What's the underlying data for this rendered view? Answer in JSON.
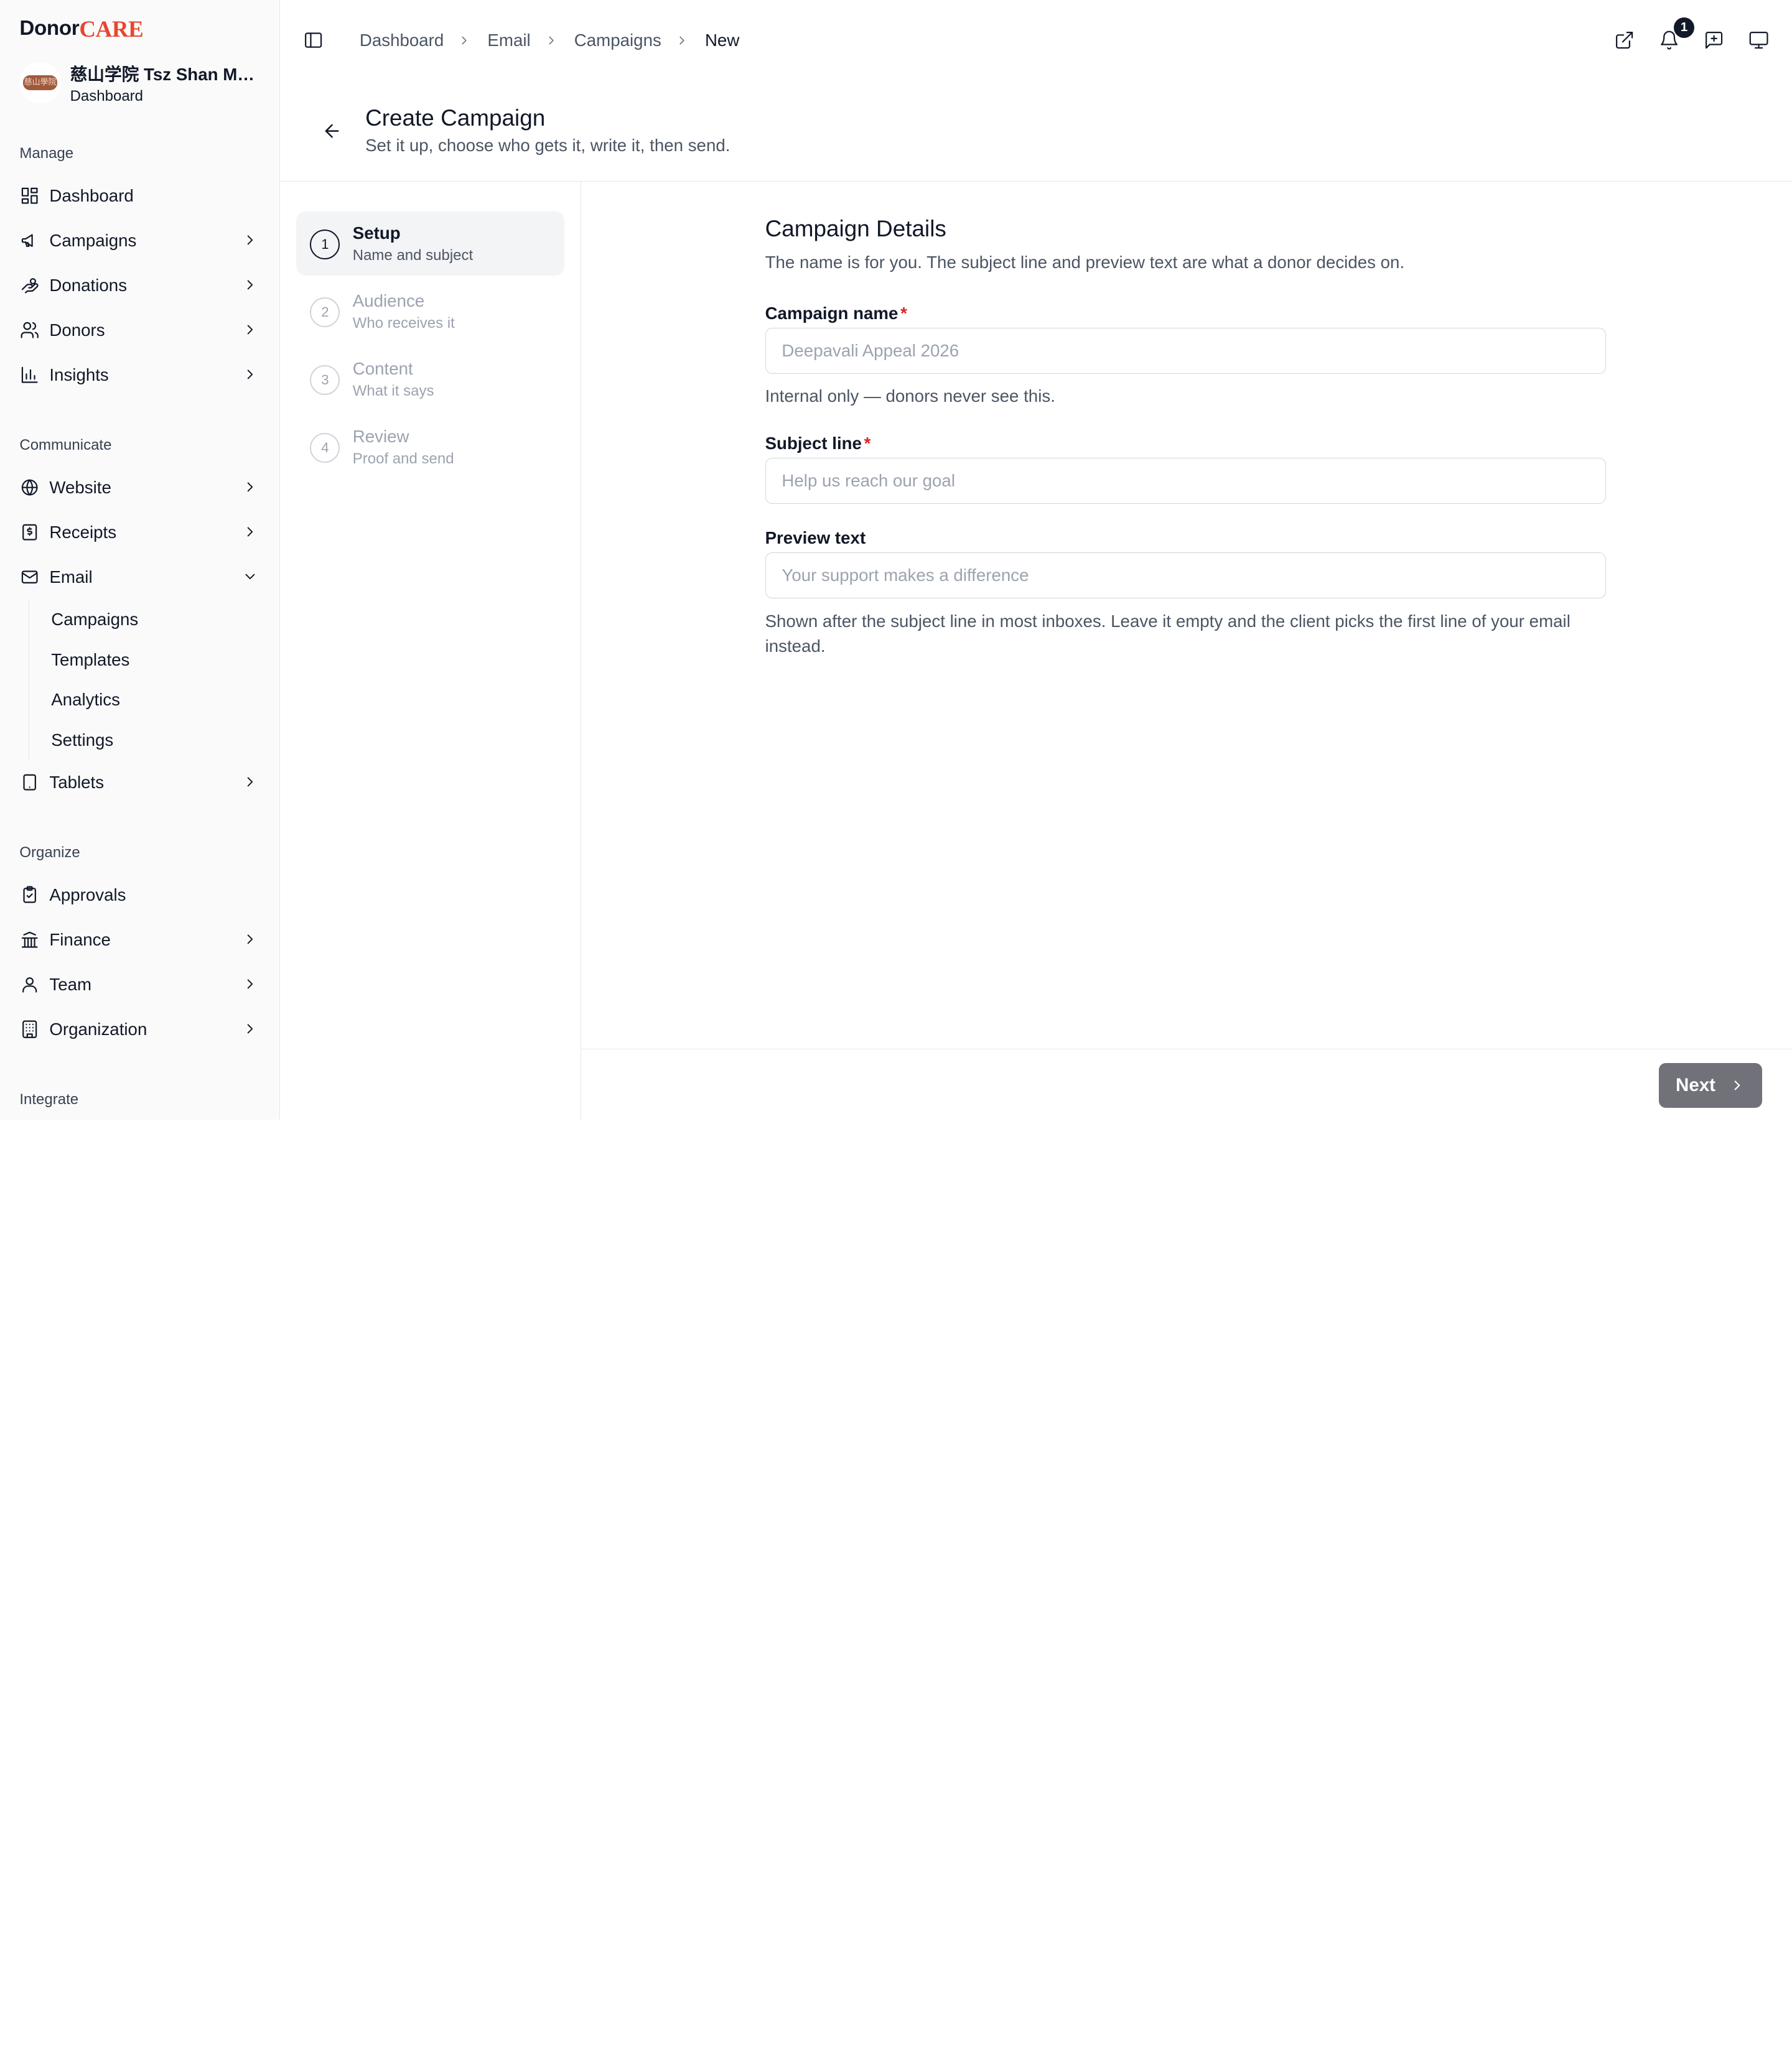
{
  "brand": {
    "donor": "Donor",
    "care": "CARE"
  },
  "org": {
    "name": "慈山学院 Tsz Shan Mo...",
    "subtitle": "Dashboard",
    "avatar_text": "慈山學院"
  },
  "sidebar": {
    "sections": {
      "manage": "Manage",
      "communicate": "Communicate",
      "organize": "Organize",
      "integrate": "Integrate"
    },
    "items": {
      "dashboard": "Dashboard",
      "campaigns": "Campaigns",
      "donations": "Donations",
      "donors": "Donors",
      "insights": "Insights",
      "website": "Website",
      "receipts": "Receipts",
      "email": "Email",
      "tablets": "Tablets",
      "approvals": "Approvals",
      "finance": "Finance",
      "team": "Team",
      "organization": "Organization"
    },
    "email_sub": [
      "Campaigns",
      "Templates",
      "Analytics",
      "Settings"
    ]
  },
  "breadcrumb": [
    "Dashboard",
    "Email",
    "Campaigns",
    "New"
  ],
  "notifications": {
    "count": "1"
  },
  "header": {
    "title": "Create Campaign",
    "subtitle": "Set it up, choose who gets it, write it, then send."
  },
  "steps": [
    {
      "num": "1",
      "label": "Setup",
      "desc": "Name and subject"
    },
    {
      "num": "2",
      "label": "Audience",
      "desc": "Who receives it"
    },
    {
      "num": "3",
      "label": "Content",
      "desc": "What it says"
    },
    {
      "num": "4",
      "label": "Review",
      "desc": "Proof and send"
    }
  ],
  "form": {
    "title": "Campaign Details",
    "description": "The name is for you. The subject line and preview text are what a donor decides on.",
    "name": {
      "label": "Campaign name",
      "required": "*",
      "placeholder": "Deepavali Appeal 2026",
      "value": "",
      "help": "Internal only — donors never see this."
    },
    "subject": {
      "label": "Subject line",
      "required": "*",
      "placeholder": "Help us reach our goal",
      "value": ""
    },
    "preview": {
      "label": "Preview text",
      "placeholder": "Your support makes a difference",
      "value": "",
      "help": "Shown after the subject line in most inboxes. Leave it empty and the client picks the first line of your email instead."
    }
  },
  "footer": {
    "next_label": "Next"
  },
  "colors": {
    "brand_accent": "#e8462f",
    "next_button": "#71717a"
  }
}
